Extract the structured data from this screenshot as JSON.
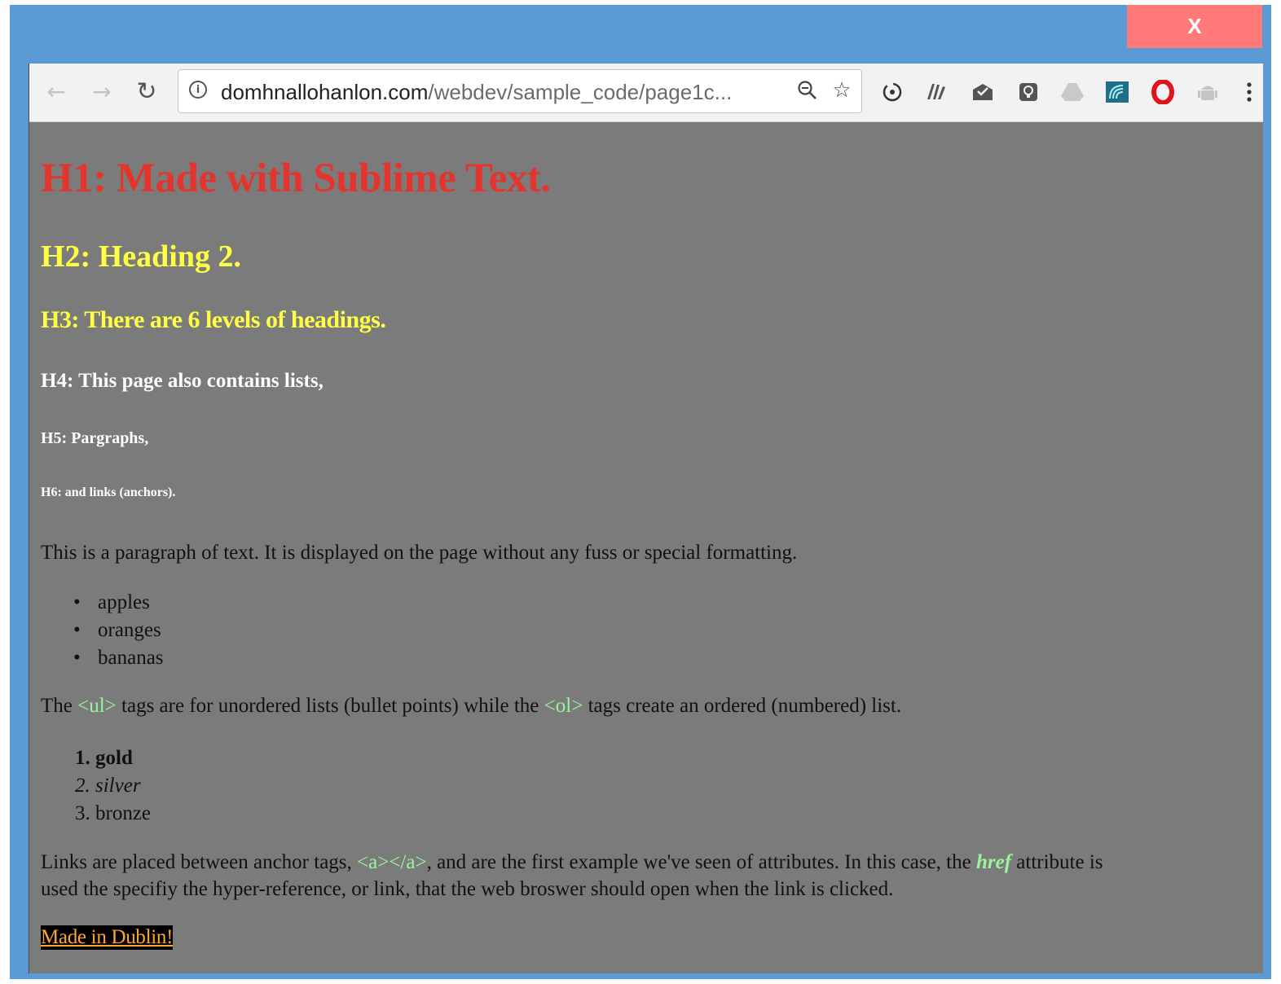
{
  "window": {
    "close_label": "X",
    "frame_color": "#5b9bd5",
    "close_color": "#ff7a78"
  },
  "toolbar": {
    "back_icon": "arrow-left-icon",
    "forward_icon": "arrow-right-icon",
    "reload_icon": "reload-icon",
    "url_host": "domhnallohanlon.com",
    "url_path": "/webdev/sample_code/page1c...",
    "info_icon": "info-icon",
    "zoom_icon": "zoom-icon",
    "bookmark_icon": "star-icon",
    "extensions": [
      "sync-icon",
      "books-icon",
      "mail-icon",
      "lightbulb-icon",
      "drive-icon",
      "wave-icon",
      "opera-icon",
      "android-icon"
    ],
    "menu_icon": "kebab-menu-icon"
  },
  "page": {
    "background": "#7b7b7b",
    "h1": "H1: Made with Sublime Text.",
    "h2": "H2: Heading 2.",
    "h3": "H3: There are 6 levels of headings.",
    "h4": "H4: This page also contains lists,",
    "h5": "H5: Pargraphs,",
    "h6": "H6: and links (anchors).",
    "paragraph1": "This is a paragraph of text. It is displayed on the page without any fuss or special formatting.",
    "unordered_list": [
      "apples",
      "oranges",
      "bananas"
    ],
    "paragraph2": {
      "part1": "The ",
      "code1": "<ul>",
      "part2": " tags are for unordered lists (bullet points) while the ",
      "code2": "<ol>",
      "part3": " tags create an ordered (numbered) list."
    },
    "ordered_list": [
      {
        "number": "1.",
        "text": "gold",
        "style": "bold"
      },
      {
        "number": "2.",
        "text": "silver",
        "style": "italic"
      },
      {
        "number": "3.",
        "text": "bronze",
        "style": "normal"
      }
    ],
    "paragraph3": {
      "part1": "Links are placed between anchor tags, ",
      "code": "<a></a>",
      "part2": ", and are the first example we've seen of attributes. In this case, the ",
      "attr": "href",
      "part3": " attribute is",
      "line2": "used the specifiy the hyper-reference, or link, that the web broswer should open when the link is clicked."
    },
    "link_text": "Made in Dublin!"
  }
}
